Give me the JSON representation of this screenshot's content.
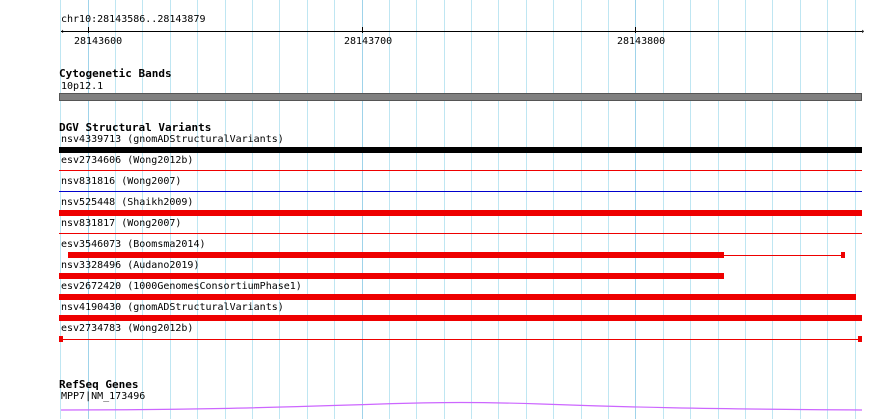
{
  "region": {
    "label": "chr10:28143586..28143879"
  },
  "ruler": {
    "ticks": [
      "28143600",
      "28143700",
      "28143800"
    ]
  },
  "cytoband": {
    "title": "Cytogenetic Bands",
    "band_label": "10p12.1",
    "band_color": "#808080"
  },
  "dgv": {
    "title": "DGV Structural Variants",
    "loss_color": "#ee0000",
    "gain_color": "#0000cc",
    "complex_color": "#000000",
    "variants": [
      {
        "label": "nsv4339713 (gnomADStructuralVariants)"
      },
      {
        "label": "esv2734606 (Wong2012b)"
      },
      {
        "label": "nsv831816 (Wong2007)"
      },
      {
        "label": "nsv525448 (Shaikh2009)"
      },
      {
        "label": "nsv831817 (Wong2007)"
      },
      {
        "label": "esv3546073 (Boomsma2014)"
      },
      {
        "label": "nsv3328496 (Audano2019)"
      },
      {
        "label": "esv2672420 (1000GenomesConsortiumPhase1)"
      },
      {
        "label": "nsv4190430 (gnomADStructuralVariants)"
      },
      {
        "label": "esv2734783 (Wong2012b)"
      }
    ]
  },
  "refseq": {
    "title": "RefSeq Genes",
    "gene_label": "MPP7|NM_173496",
    "gene_color": "#cc66ff"
  }
}
